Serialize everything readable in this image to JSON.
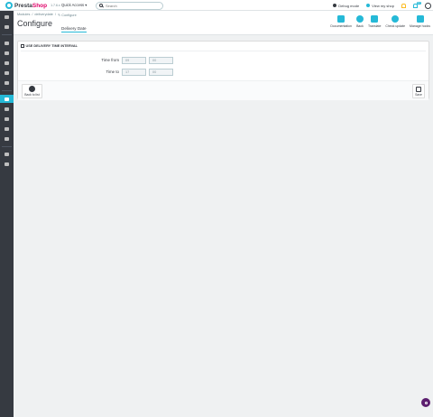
{
  "topbar": {
    "logo_text_a": "Presta",
    "logo_text_b": "Shop",
    "version": "1.7.6.x",
    "quick_access": "Quick Access ▾",
    "search_placeholder": "Search",
    "debug_mode": "Debug mode",
    "view_shop": "View my shop",
    "notif_count": "12"
  },
  "breadcrumb": [
    "Modules",
    "deliverydate",
    "Configure"
  ],
  "page": {
    "title": "Configure",
    "module_tab": "Delivery Date"
  },
  "toolbar": [
    {
      "label": "Documentation",
      "icon": "book-icon"
    },
    {
      "label": "Back",
      "icon": "arrow-left-icon"
    },
    {
      "label": "Translate",
      "icon": "flag-icon"
    },
    {
      "label": "Check update",
      "icon": "refresh-icon"
    },
    {
      "label": "Manage hooks",
      "icon": "anchor-icon"
    }
  ],
  "panel": {
    "heading": "USE DELIVERY TIME INTERVAL",
    "time_from_label": "Time from",
    "time_to_label": "Time to",
    "time_from_h": "09",
    "time_from_m": "00",
    "time_to_h": "17",
    "time_to_m": "00",
    "back_label": "Back to list",
    "save_label": "Save"
  },
  "colors": {
    "accent": "#25b9d7",
    "sidebar": "#363a41",
    "brand": "#df0067",
    "help_fab": "#5b1e6e"
  }
}
